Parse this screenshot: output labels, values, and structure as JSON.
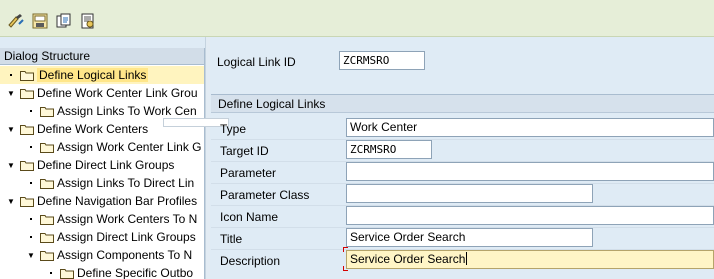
{
  "toolbar": {
    "buttons": [
      {
        "name": "display-change-icon"
      },
      {
        "name": "save-icon"
      },
      {
        "name": "copy-entry-icon"
      },
      {
        "name": "details-icon"
      }
    ]
  },
  "tree": {
    "header": "Dialog Structure",
    "nodes": [
      {
        "label": "Define Logical Links",
        "expander": "dot",
        "selected": true
      },
      {
        "label": "Define Work Center Link Grou",
        "expander": "open"
      },
      {
        "label": "Assign Links To Work Cen",
        "expander": "dot"
      },
      {
        "label": "Define Work Centers",
        "expander": "open"
      },
      {
        "label": "Assign Work Center Link G",
        "expander": "dot"
      },
      {
        "label": "Define Direct Link Groups",
        "expander": "open"
      },
      {
        "label": "Assign Links To Direct Lin",
        "expander": "dot"
      },
      {
        "label": "Define Navigation Bar Profiles",
        "expander": "open"
      },
      {
        "label": "Assign Work Centers To N",
        "expander": "dot"
      },
      {
        "label": "Assign Direct Link Groups",
        "expander": "dot"
      },
      {
        "label": "Assign Components To N",
        "expander": "open"
      },
      {
        "label": "Define Specific Outbo",
        "expander": "dot"
      }
    ]
  },
  "key_field": {
    "label": "Logical Link ID",
    "value": "ZCRMSRO"
  },
  "group": {
    "title": "Define Logical Links",
    "fields": {
      "type": {
        "label": "Type",
        "value": "Work Center"
      },
      "target_id": {
        "label": "Target ID",
        "value": "ZCRMSRO"
      },
      "parameter": {
        "label": "Parameter",
        "value": ""
      },
      "parameter_class": {
        "label": "Parameter Class",
        "value": ""
      },
      "icon_name": {
        "label": "Icon Name",
        "value": ""
      },
      "title": {
        "label": "Title",
        "value": "Service Order Search"
      },
      "description": {
        "label": "Description",
        "value": "Service Order Search"
      }
    }
  },
  "colors": {
    "background": "#dfebf5",
    "toolbar": "#e6eed8",
    "selection": "#ffe68a",
    "active_field": "#fff5c6"
  }
}
